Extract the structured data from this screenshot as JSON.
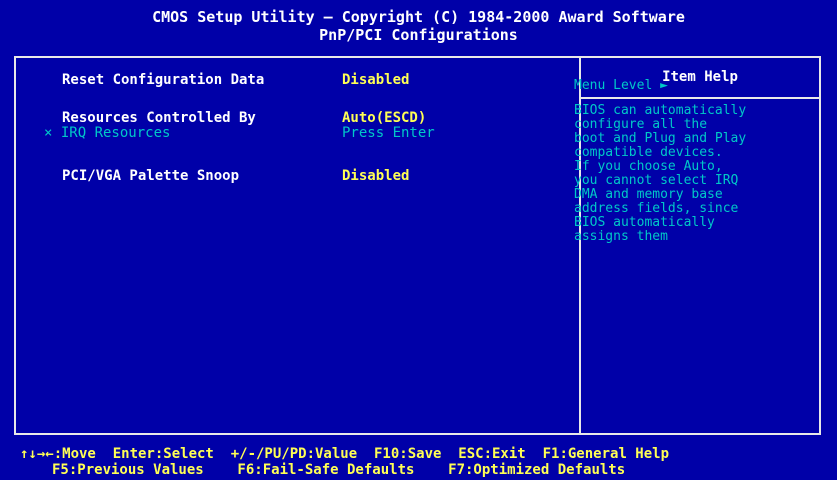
{
  "header": {
    "title_line1": "CMOS Setup Utility – Copyright (C) 1984-2000 Award Software",
    "title_line2": "PnP/PCI Configurations"
  },
  "menu": {
    "items": [
      {
        "label": "Reset Configuration Data",
        "value": "Disabled"
      },
      {
        "label": "Resources Controlled By",
        "value": "Auto(ESCD)",
        "selected": true
      },
      {
        "label": "× IRQ Resources",
        "value": "Press Enter",
        "disabled": true
      },
      {
        "label": "PCI/VGA Palette Snoop",
        "value": "Disabled"
      }
    ]
  },
  "help": {
    "title": "Item Help",
    "menu_level": "Menu Level   ►",
    "text": "BIOS can automatically\nconfigure all the\nboot and Plug and Play\ncompatible devices.\nIf you choose Auto,\nyou cannot select IRQ\nDMA and memory base\naddress fields, since\nBIOS automatically\nassigns them"
  },
  "footer": {
    "line1": "↑↓→←:Move  Enter:Select  +/-/PU/PD:Value  F10:Save  ESC:Exit  F1:General Help",
    "line2": "F5:Previous Values    F6:Fail-Safe Defaults    F7:Optimized Defaults"
  },
  "colors": {
    "background": "#0000a8",
    "highlight": "#c80000",
    "value": "#ffff54",
    "help": "#00c8c8"
  }
}
